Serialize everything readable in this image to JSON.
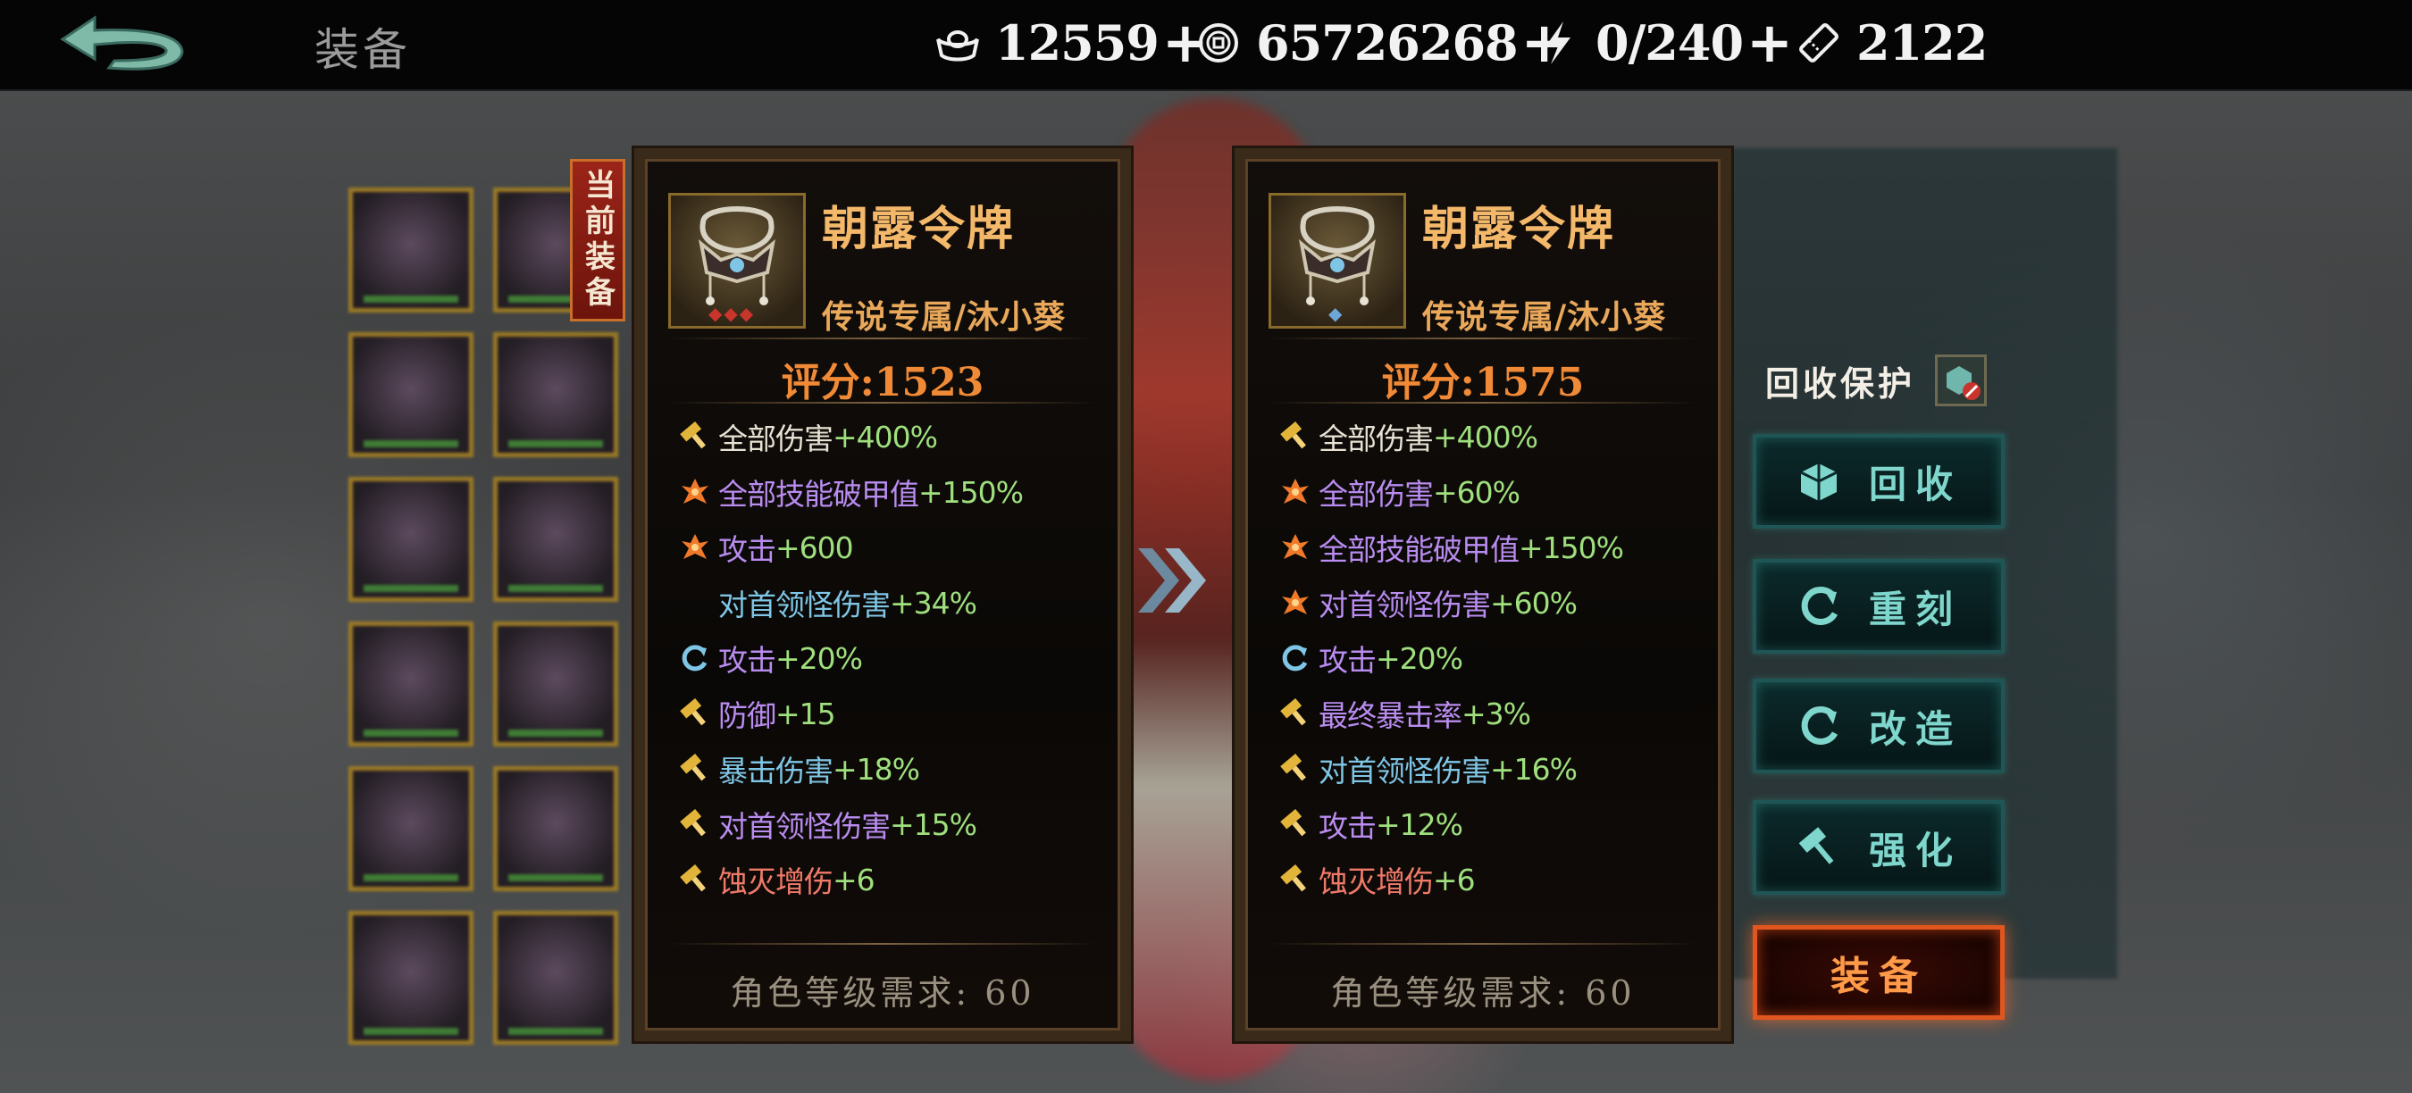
{
  "header": {
    "page_title": "装备",
    "resources": [
      {
        "icon": "silver-ingot-icon",
        "value": "12559",
        "plus": "+"
      },
      {
        "icon": "copper-coin-icon",
        "value": "65726268",
        "plus": "+"
      },
      {
        "icon": "lightning-icon",
        "value": "0/240",
        "plus": "+"
      },
      {
        "icon": "ticket-icon",
        "value": "2122",
        "plus": ""
      }
    ]
  },
  "current_tag": "当前装备",
  "cards": [
    {
      "name": "朝露令牌",
      "subtitle": "传说专属/沐小葵",
      "score": "评分:1523",
      "stars": "◆◆◆",
      "stats": [
        {
          "icon": "hammer-icon",
          "label": "全部伤害",
          "label_color": "#e8e2d4",
          "bonus": "+400%"
        },
        {
          "icon": "flame-icon",
          "label": "全部技能破甲值",
          "label_color": "#b98cf0",
          "bonus": "+150%"
        },
        {
          "icon": "flame-icon",
          "label": "攻击",
          "label_color": "#b98cf0",
          "bonus": "+600"
        },
        {
          "icon": "",
          "label": "对首领怪伤害",
          "label_color": "#7fc6e6",
          "bonus": "+34%"
        },
        {
          "icon": "refresh-icon",
          "label": "攻击",
          "label_color": "#b98cf0",
          "bonus": "+20%"
        },
        {
          "icon": "hammer-icon",
          "label": "防御",
          "label_color": "#b98cf0",
          "bonus": "+15"
        },
        {
          "icon": "hammer-icon",
          "label": "暴击伤害",
          "label_color": "#7fc6e6",
          "bonus": "+18%"
        },
        {
          "icon": "hammer-icon",
          "label": "对首领怪伤害",
          "label_color": "#b98cf0",
          "bonus": "+15%"
        },
        {
          "icon": "hammer-icon",
          "label": "蚀灭增伤",
          "label_color": "#f07a6a",
          "bonus": "+6"
        }
      ],
      "requirement": "角色等级需求: 60"
    },
    {
      "name": "朝露令牌",
      "subtitle": "传说专属/沐小葵",
      "score": "评分:1575",
      "stars": "◆",
      "stats": [
        {
          "icon": "hammer-icon",
          "label": "全部伤害",
          "label_color": "#e8e2d4",
          "bonus": "+400%"
        },
        {
          "icon": "flame-icon",
          "label": "全部伤害",
          "label_color": "#b98cf0",
          "bonus": "+60%"
        },
        {
          "icon": "flame-icon",
          "label": "全部技能破甲值",
          "label_color": "#b98cf0",
          "bonus": "+150%"
        },
        {
          "icon": "flame-icon",
          "label": "对首领怪伤害",
          "label_color": "#b98cf0",
          "bonus": "+60%"
        },
        {
          "icon": "refresh-icon",
          "label": "攻击",
          "label_color": "#b98cf0",
          "bonus": "+20%"
        },
        {
          "icon": "hammer-icon",
          "label": "最终暴击率",
          "label_color": "#b98cf0",
          "bonus": "+3%"
        },
        {
          "icon": "hammer-icon",
          "label": "对首领怪伤害",
          "label_color": "#7fc6e6",
          "bonus": "+16%"
        },
        {
          "icon": "hammer-icon",
          "label": "攻击",
          "label_color": "#b98cf0",
          "bonus": "+12%"
        },
        {
          "icon": "hammer-icon",
          "label": "蚀灭增伤",
          "label_color": "#f07a6a",
          "bonus": "+6"
        }
      ],
      "requirement": "角色等级需求: 60"
    }
  ],
  "actions": {
    "protect_label": "回收保护",
    "recycle": "回收",
    "reforge": "重刻",
    "modify": "改造",
    "enhance": "强化",
    "equip": "装备"
  }
}
